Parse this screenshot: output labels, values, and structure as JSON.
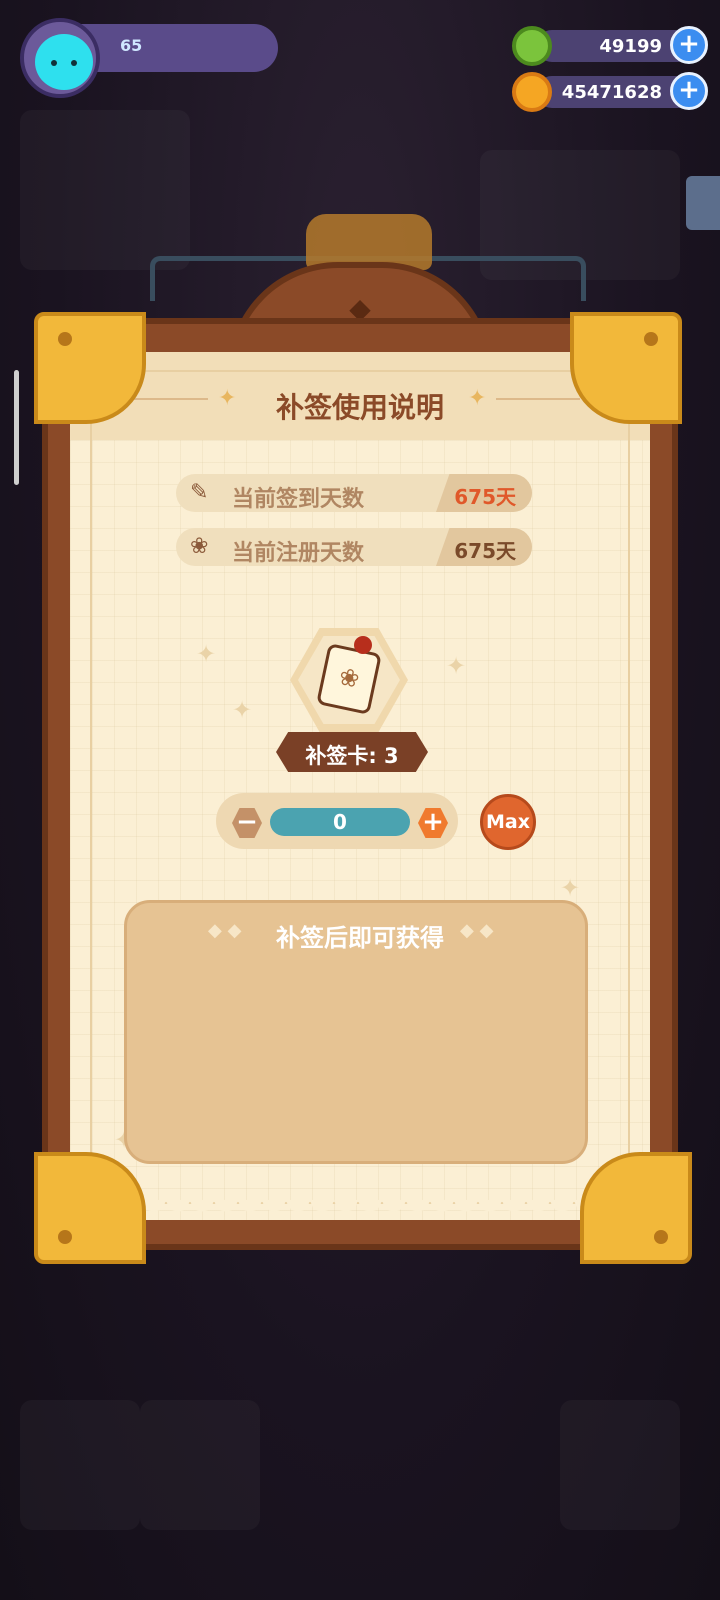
{
  "player": {
    "level": "65"
  },
  "currencies": [
    {
      "name": "green-donut-icon",
      "value": "49199",
      "color": "#7bc43c"
    },
    {
      "name": "planet-coin-icon",
      "value": "45471628",
      "color": "#f5a623"
    }
  ],
  "dialog": {
    "title": "补签使用说明",
    "stats": [
      {
        "label": "当前签到天数",
        "value": "675天",
        "value_color": "#e0582a",
        "icon": "pencil-icon"
      },
      {
        "label": "当前注册天数",
        "value": "675天",
        "value_color": "#7a4a2a",
        "icon": "paw-icon"
      }
    ],
    "card": {
      "label": "补签卡: 3"
    },
    "quantity": {
      "value": "0",
      "max_label": "Max"
    },
    "reward": {
      "title": "补签后即可获得"
    }
  },
  "colors": {
    "frame": "#8b4a28",
    "paper": "#fbefd4",
    "accent": "#e0662e",
    "gold": "#f2b83a"
  }
}
